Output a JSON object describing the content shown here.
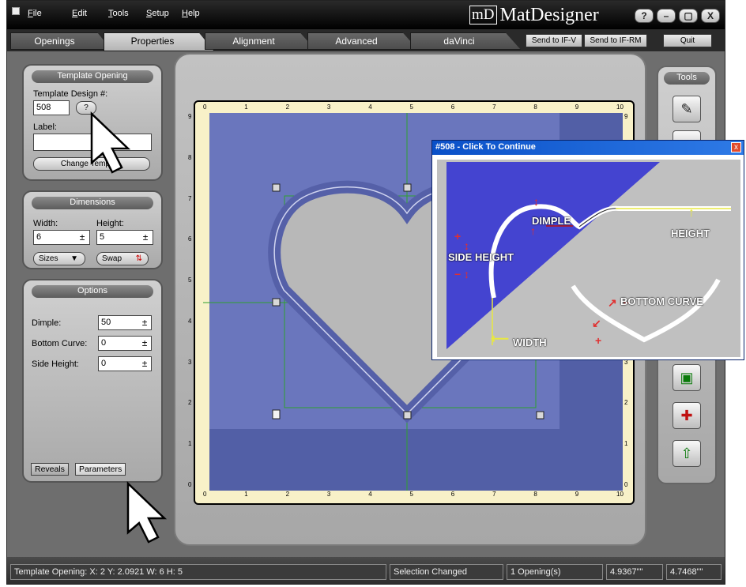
{
  "menu": {
    "file": "File",
    "edit": "Edit",
    "tools": "Tools",
    "setup": "Setup",
    "help": "Help"
  },
  "logo": {
    "mark": "mD",
    "name": "MatDesigner"
  },
  "window_buttons": {
    "help": "?",
    "min": "–",
    "max": "▢",
    "close": "X"
  },
  "tabs": [
    "Openings",
    "Properties",
    "Alignment",
    "Advanced",
    "daVinci"
  ],
  "right_buttons": {
    "send_ifv": "Send to IF-V",
    "send_ifrm": "Send to IF-RM",
    "quit": "Quit"
  },
  "template_panel": {
    "title": "Template Opening",
    "design_label": "Template Design #:",
    "design_value": "508",
    "help_btn": "?",
    "label_label": "Label:",
    "label_value": "",
    "change_btn": "Change Templa..."
  },
  "dimensions_panel": {
    "title": "Dimensions",
    "width_label": "Width:",
    "height_label": "Height:",
    "width_value": "6",
    "height_value": "5",
    "sizes_btn": "Sizes",
    "swap_btn": "Swap"
  },
  "options_panel": {
    "title": "Options",
    "dimple_label": "Dimple:",
    "dimple_value": "50",
    "bottom_label": "Bottom Curve:",
    "bottom_value": "0",
    "side_label": "Side Height:",
    "side_value": "0",
    "tab_reveals": "Reveals",
    "tab_parameters": "Parameters"
  },
  "ruler": {
    "top": [
      "0",
      "1",
      "2",
      "3",
      "4",
      "5",
      "6",
      "7",
      "8",
      "9",
      "10"
    ],
    "left": [
      "9",
      "8",
      "7",
      "6",
      "5",
      "4",
      "3",
      "2",
      "1",
      "0"
    ]
  },
  "tools_panel": {
    "title": "Tools"
  },
  "popup": {
    "title": "#508 - Click To Continue",
    "close": "x",
    "dimple": "DIMPLE",
    "height": "HEIGHT",
    "side_height": "SIDE HEIGHT",
    "bottom_curve": "BOTTOM CURVE",
    "width": "WIDTH"
  },
  "status": {
    "info": "Template Opening:  X: 2   Y: 2.0921    W: 6   H: 5",
    "message": "Selection Changed",
    "count": "1 Opening(s)",
    "dim1": "4.9367\"\"",
    "dim2": "4.7468\"\""
  },
  "colors": {
    "mat": "#525fa6",
    "opening": "#6a76bd",
    "ruler": "#f8f1c8",
    "guide": "#2ea02e",
    "popup_title": "#0a50c8"
  }
}
